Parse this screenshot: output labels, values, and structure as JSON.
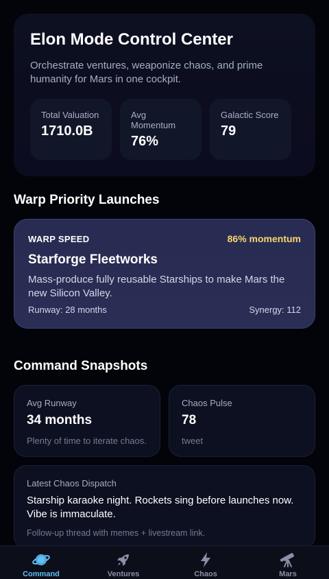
{
  "hero": {
    "title": "Elon Mode Control Center",
    "subtitle": "Orchestrate ventures, weaponize chaos, and prime humanity for Mars in one cockpit.",
    "stats": [
      {
        "label": "Total Valuation",
        "value": "1710.0B"
      },
      {
        "label": "Avg Momentum",
        "value": "76%"
      },
      {
        "label": "Galactic Score",
        "value": "79"
      }
    ]
  },
  "launches": {
    "section_title": "Warp Priority Launches",
    "card": {
      "tag": "WARP SPEED",
      "momentum": "86% momentum",
      "name": "Starforge Fleetworks",
      "description": "Mass-produce fully reusable Starships to make Mars the new Silicon Valley.",
      "runway": "Runway: 28 months",
      "synergy": "Synergy: 112"
    }
  },
  "snapshots": {
    "section_title": "Command Snapshots",
    "runway": {
      "label": "Avg Runway",
      "value": "34 months",
      "note": "Plenty of time to iterate chaos."
    },
    "chaos": {
      "label": "Chaos Pulse",
      "value": "78",
      "note": "tweet"
    },
    "dispatch": {
      "label": "Latest Chaos Dispatch",
      "text": "Starship karaoke night. Rockets sing before launches now. Vibe is immaculate.",
      "note": "Follow-up thread with memes + livestream link."
    }
  },
  "nav": {
    "items": [
      {
        "label": "Command",
        "icon": "planet-icon",
        "active": true
      },
      {
        "label": "Ventures",
        "icon": "rocket-icon",
        "active": false
      },
      {
        "label": "Chaos",
        "icon": "bolt-icon",
        "active": false
      },
      {
        "label": "Mars",
        "icon": "telescope-icon",
        "active": false
      }
    ]
  },
  "colors": {
    "accent": "#5fc0f5",
    "momentum": "#f6d56f",
    "background": "#03040a"
  }
}
